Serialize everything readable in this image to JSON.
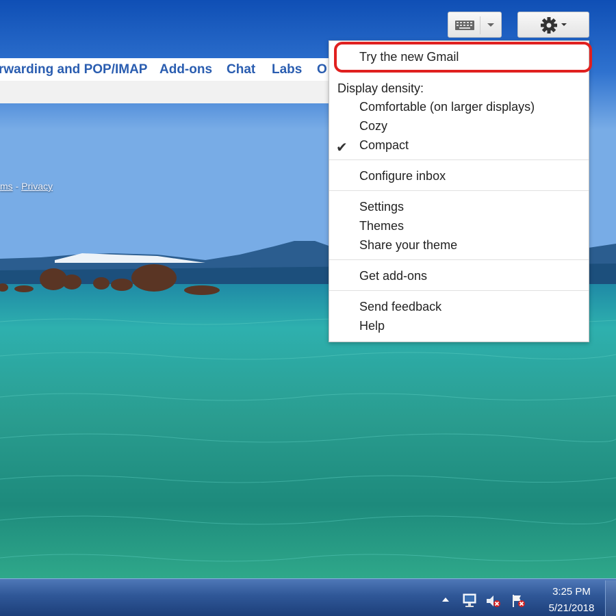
{
  "toolbar": {
    "keyboard_icon": "keyboard-icon",
    "gear_icon": "gear-icon"
  },
  "settings_tabs": {
    "items": [
      {
        "label": "rwarding and POP/IMAP"
      },
      {
        "label": "Add-ons"
      },
      {
        "label": "Chat"
      },
      {
        "label": "Labs"
      },
      {
        "label": "O"
      }
    ]
  },
  "footer": {
    "terms": "ms",
    "separator": "-",
    "privacy": "Privacy"
  },
  "menu": {
    "try_new": "Try the new Gmail",
    "density_header": "Display density:",
    "density_options": [
      {
        "label": "Comfortable (on larger displays)",
        "checked": false
      },
      {
        "label": "Cozy",
        "checked": false
      },
      {
        "label": "Compact",
        "checked": true
      }
    ],
    "configure_inbox": "Configure inbox",
    "settings": "Settings",
    "themes": "Themes",
    "share_theme": "Share your theme",
    "get_addons": "Get add-ons",
    "send_feedback": "Send feedback",
    "help": "Help",
    "check_glyph": "✔"
  },
  "taskbar": {
    "time": "3:25 PM",
    "date": "5/21/2018",
    "tray_icons": [
      "show-hidden-icons-arrow",
      "network-icon",
      "volume-muted-icon",
      "action-center-flag-icon"
    ]
  },
  "colors": {
    "link_blue": "#2a5db0",
    "highlight_red": "#e0201f",
    "taskbar_blue": "#2f5797"
  }
}
